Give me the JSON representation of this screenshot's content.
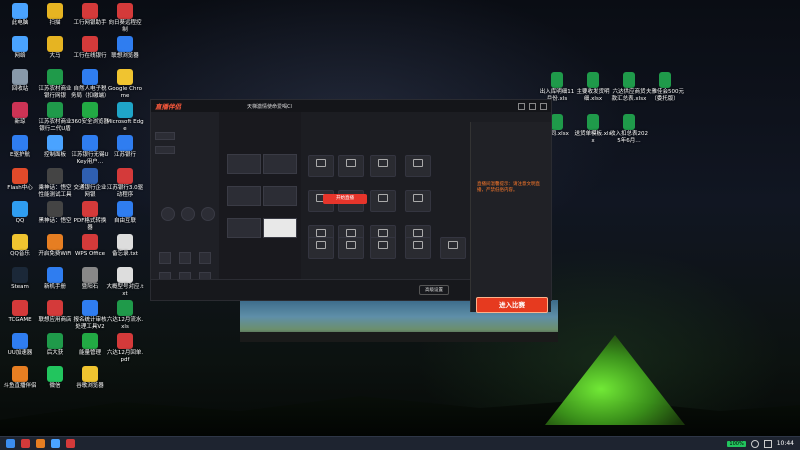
{
  "desktop_icons": [
    {
      "label": "此电脑",
      "color": "#4aa3ff"
    },
    {
      "label": "扫描",
      "color": "#e6b422"
    },
    {
      "label": "工行网银助手",
      "color": "#d43a3a"
    },
    {
      "label": "向日葵远程控制",
      "color": "#d43a3a"
    },
    {
      "label": "网络",
      "color": "#4aa3ff"
    },
    {
      "label": "大马",
      "color": "#e6b422"
    },
    {
      "label": "工行在线银行",
      "color": "#d43a3a"
    },
    {
      "label": "联想浏览器",
      "color": "#2f7df0"
    },
    {
      "label": "回收站",
      "color": "#8899aa"
    },
    {
      "label": "江苏农村商业银行网银",
      "color": "#1f9a4a"
    },
    {
      "label": "自然人电子税务局（扣缴端）",
      "color": "#2f7df0"
    },
    {
      "label": "Google Chrome",
      "color": "#f0c430"
    },
    {
      "label": "新琼",
      "color": "#cc3355"
    },
    {
      "label": "江苏农村商业银行二代U盾",
      "color": "#1f9a4a"
    },
    {
      "label": "360安全浏览器",
      "color": "#22aa44"
    },
    {
      "label": "Microsoft Edge",
      "color": "#1fa5c8"
    },
    {
      "label": "E驱护航",
      "color": "#2f7df0"
    },
    {
      "label": "控制面板",
      "color": "#4aa3ff"
    },
    {
      "label": "江苏银行无锡UKey用户…",
      "color": "#2f7df0"
    },
    {
      "label": "江苏银行",
      "color": "#2f7df0"
    },
    {
      "label": "Flash中心",
      "color": "#e04a2a"
    },
    {
      "label": "乘神话：悟空性能测试工具",
      "color": "#444"
    },
    {
      "label": "交通银行企业网银",
      "color": "#2f5fb0"
    },
    {
      "label": "江苏银行3.0驱动程序",
      "color": "#d43a3a"
    },
    {
      "label": "QQ",
      "color": "#2f9df0"
    },
    {
      "label": "黑神话：悟空",
      "color": "#444"
    },
    {
      "label": "PDF格式转换器",
      "color": "#d43a3a"
    },
    {
      "label": "自由互联",
      "color": "#2f7df0"
    },
    {
      "label": "QQ音乐",
      "color": "#f0c430"
    },
    {
      "label": "开启免费WiFi",
      "color": "#e67e22"
    },
    {
      "label": "WPS Office",
      "color": "#d43a3a"
    },
    {
      "label": "备忘录.txt",
      "color": "#dddddd"
    },
    {
      "label": "Steam",
      "color": "#1b2838"
    },
    {
      "label": "新机手册",
      "color": "#2f7df0"
    },
    {
      "label": "暨阳石",
      "color": "#888"
    },
    {
      "label": "大概型号对应.txt",
      "color": "#dddddd"
    },
    {
      "label": "TCGAME",
      "color": "#d43a3a"
    },
    {
      "label": "联想应用商店",
      "color": "#d43a3a"
    },
    {
      "label": "报名统计审核处理工具V2",
      "color": "#2f7df0"
    },
    {
      "label": "六达12月流水.xls",
      "color": "#1f9a4a"
    },
    {
      "label": "UU加速器",
      "color": "#2f7df0"
    },
    {
      "label": "后大获",
      "color": "#1f9a4a"
    },
    {
      "label": "能量管理",
      "color": "#22aa44"
    },
    {
      "label": "六达12月回单.pdf",
      "color": "#d43a3a"
    },
    {
      "label": "斗鱼直播伴侣",
      "color": "#e67e22"
    },
    {
      "label": "微信",
      "color": "#22c55e"
    },
    {
      "label": "谷歌浏览器",
      "color": "#f0c430"
    }
  ],
  "right_files": [
    {
      "label": "出入库明细11月份.xls",
      "color": "#1f9a4a"
    },
    {
      "label": "主要收发货明细.xlsx",
      "color": "#1f9a4a"
    },
    {
      "label": "六达供应商货款汇总表.xlsx",
      "color": "#1f9a4a"
    },
    {
      "label": "夫雅佳会500元（委托版）",
      "color": "#1f9a4a"
    },
    {
      "label": "合同.xlsx",
      "color": "#1f9a4a"
    },
    {
      "label": "送货单模板.xlsx",
      "color": "#1f9a4a"
    },
    {
      "label": "收入扣总表2025年6月…",
      "color": "#1f9a4a"
    }
  ],
  "app": {
    "brand": "直播伴侣",
    "stream_title": "天梯激情使命爱喝Cl",
    "start_live": "开始直播",
    "overlay_warning": "直播间温馨提示：请注意文明直播，严禁低俗内容。",
    "enter_button": "进入比赛",
    "bottom_button": "高级设置"
  },
  "taskbar": {
    "battery": "100%",
    "time": "10:44"
  }
}
